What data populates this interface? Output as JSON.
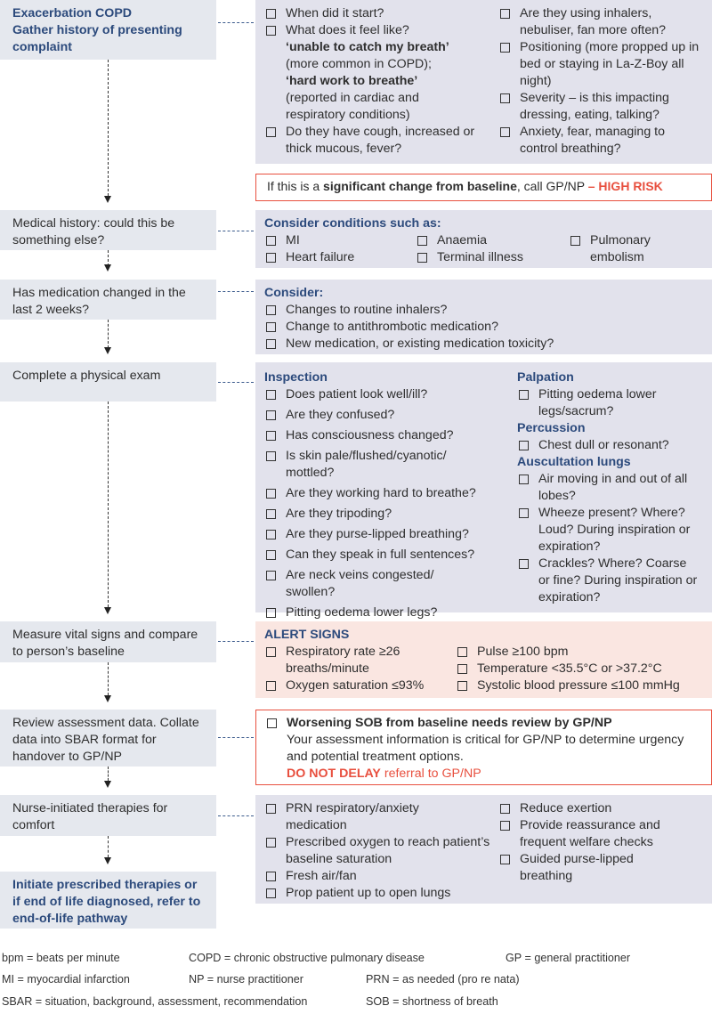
{
  "steps": {
    "s1": {
      "line1": "Exacerbation COPD",
      "line2": "Gather history of presenting complaint"
    },
    "s2": "Medical history: could this be something else?",
    "s3": "Has medication changed in the last 2 weeks?",
    "s4": "Complete a physical exam",
    "s5": "Measure vital signs and compare to person’s baseline",
    "s6": "Review assessment data. Collate data into SBAR format for handover to GP/NP",
    "s7": "Nurse-initiated therapies for comfort",
    "s8": "Initiate prescribed therapies or if end of life diagnosed, refer to end-of-life pathway"
  },
  "history": {
    "left": {
      "i1": "When did it start?",
      "i2": "What does it feel like?",
      "q1": "‘unable to catch my breath’",
      "q1_note": "(more common in COPD);",
      "q2": "‘hard work to breathe’",
      "q2_note": "(reported in cardiac and respiratory conditions)",
      "i3": "Do they have cough, increased or thick mucous, fever?"
    },
    "right": [
      "Are they using inhalers, nebuliser, fan more often?",
      "Positioning (more propped up in bed or staying in La-Z-Boy all night)",
      "Severity – is this impacting dressing, eating, talking?",
      "Anxiety, fear, managing to control breathing?"
    ]
  },
  "high_risk": {
    "pre": "If this is a ",
    "bold": "significant change from baseline",
    "mid": ", call GP/NP ",
    "red": "– HIGH RISK"
  },
  "conditions": {
    "header": "Consider conditions such as:",
    "col1": [
      "MI",
      "Heart failure"
    ],
    "col2": [
      "Anaemia",
      "Terminal illness"
    ],
    "col3": [
      "Pulmonary embolism"
    ]
  },
  "medication": {
    "header": "Consider:",
    "items": [
      "Changes to routine inhalers?",
      "Change to antithrombotic medication?",
      "New medication, or existing medication toxicity?"
    ]
  },
  "exam": {
    "inspection": {
      "header": "Inspection",
      "items": [
        "Does patient look well/ill?",
        "Are they confused?",
        "Has consciousness changed?",
        "Is skin pale/flushed/cyanotic/ mottled?",
        "Are they working hard to breathe?",
        "Are they tripoding?",
        "Are they purse-lipped breathing?",
        "Can they speak in full sentences?",
        "Are neck veins congested/ swollen?",
        "Pitting oedema lower legs?"
      ]
    },
    "palpation": {
      "header": "Palpation",
      "items": [
        "Pitting oedema lower legs/sacrum?"
      ]
    },
    "percussion": {
      "header": "Percussion",
      "items": [
        "Chest dull or resonant?"
      ]
    },
    "auscultation": {
      "header": "Auscultation lungs",
      "items": [
        "Air moving in and out of all lobes?",
        "Wheeze present? Where? Loud? During inspiration or expiration?",
        "Crackles? Where? Coarse or fine? During inspiration or expiration?"
      ]
    }
  },
  "alert": {
    "header": "ALERT SIGNS",
    "left": [
      "Respiratory rate ≥26 breaths/minute",
      "Oxygen saturation ≤93%"
    ],
    "right": [
      "Pulse ≥100 bpm",
      "Temperature <35.5°C  or >37.2°C",
      "Systolic blood pressure ≤100 mmHg"
    ]
  },
  "review": {
    "item": "Worsening SOB from baseline needs review by GP/NP",
    "body": "Your assessment information is critical for GP/NP to determine urgency and potential treatment options.",
    "red_bold": "DO NOT DELAY",
    "red_rest": " referral to GP/NP"
  },
  "therapies": {
    "left": [
      "PRN respiratory/anxiety medication",
      "Prescribed oxygen to reach patient’s baseline saturation",
      "Fresh air/fan",
      "Prop patient up to open lungs"
    ],
    "right": [
      "Reduce exertion",
      "Provide reassurance and frequent welfare checks",
      "Guided purse-lipped breathing"
    ]
  },
  "legend": {
    "bpm": "bpm = beats per minute",
    "copd": "COPD = chronic obstructive pulmonary disease",
    "gp": "GP = general practitioner",
    "mi": "MI = myocardial infarction",
    "np": "NP = nurse practitioner",
    "prn": "PRN = as needed (pro re nata)",
    "sbar": "SBAR = situation, background, assessment, recommendation",
    "sob": "SOB = shortness of breath"
  },
  "colors": {
    "step_bg": "#e5e8ee",
    "panel_bg": "#e2e2ec",
    "alert_bg": "#fae6e1",
    "accent_blue": "#2c4a7c",
    "alert_red": "#e8503f"
  }
}
